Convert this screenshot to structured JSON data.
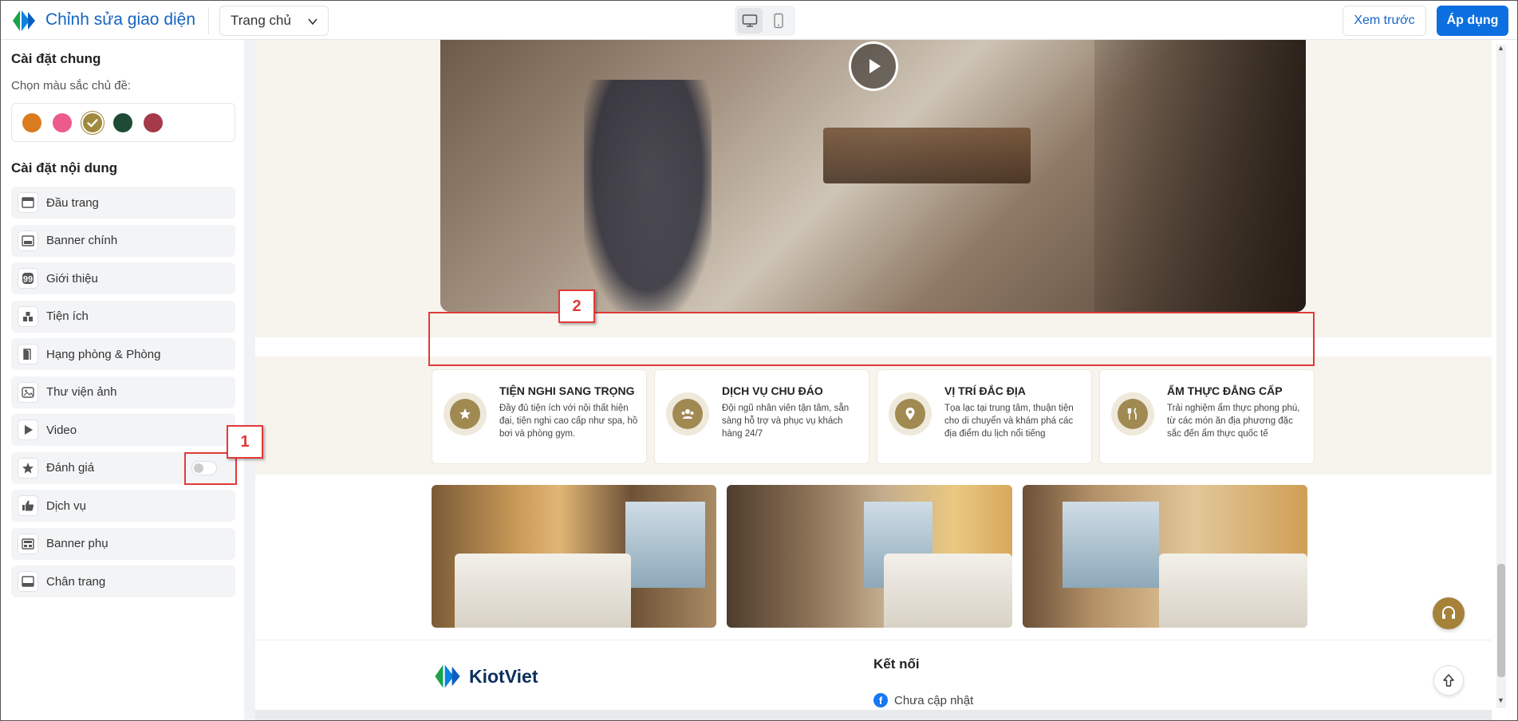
{
  "header": {
    "title": "Chỉnh sửa giao diện",
    "page_select": "Trang chủ",
    "preview_label": "Xem trước",
    "apply_label": "Áp dụng"
  },
  "sidebar": {
    "general_title": "Cài đặt chung",
    "color_label": "Chọn màu sắc chủ đề:",
    "colors": [
      "#d97b1e",
      "#ec5b8a",
      "#a08a3d",
      "#1f4a35",
      "#a53a4a"
    ],
    "selected_color_index": 2,
    "content_title": "Cài đặt nội dung",
    "items": [
      {
        "label": "Đầu trang",
        "icon": "header-layout-icon"
      },
      {
        "label": "Banner chính",
        "icon": "banner-icon"
      },
      {
        "label": "Giới thiệu",
        "icon": "quote-icon"
      },
      {
        "label": "Tiện ích",
        "icon": "amenities-icon"
      },
      {
        "label": "Hạng phòng & Phòng",
        "icon": "door-icon"
      },
      {
        "label": "Thư viện ảnh",
        "icon": "image-icon"
      },
      {
        "label": "Video",
        "icon": "play-icon"
      },
      {
        "label": "Đánh giá",
        "icon": "star-icon",
        "toggle": false
      },
      {
        "label": "Dịch vụ",
        "icon": "thumbs-up-icon"
      },
      {
        "label": "Banner phụ",
        "icon": "sub-banner-icon"
      },
      {
        "label": "Chân trang",
        "icon": "footer-layout-icon"
      }
    ]
  },
  "annotations": [
    "1",
    "2"
  ],
  "features": [
    {
      "title": "TIỆN NGHI SANG TRỌNG",
      "desc": "Đầy đủ tiện ích với nội thất hiện đại, tiện nghi cao cấp như spa, hồ bơi và phòng gym.",
      "icon": "star-icon"
    },
    {
      "title": "DỊCH VỤ CHU ĐÁO",
      "desc": "Đội ngũ nhân viên tận tâm, sẵn sàng hỗ trợ và phục vụ khách hàng 24/7",
      "icon": "staff-icon"
    },
    {
      "title": "VỊ TRÍ ĐẮC ĐỊA",
      "desc": "Tọa lạc tại trung tâm, thuận tiện cho di chuyển và khám phá các địa điểm du lịch nổi tiếng",
      "icon": "location-icon"
    },
    {
      "title": "ẨM THỰC ĐẲNG CẤP",
      "desc": "Trải nghiệm ẩm thực phong phú, từ các món ăn địa phương đặc sắc đến ẩm thực quốc tế",
      "icon": "dining-icon"
    }
  ],
  "footer": {
    "brand": "KiotViet",
    "connect_title": "Kết nối",
    "facebook_text": "Chưa cập nhật"
  }
}
